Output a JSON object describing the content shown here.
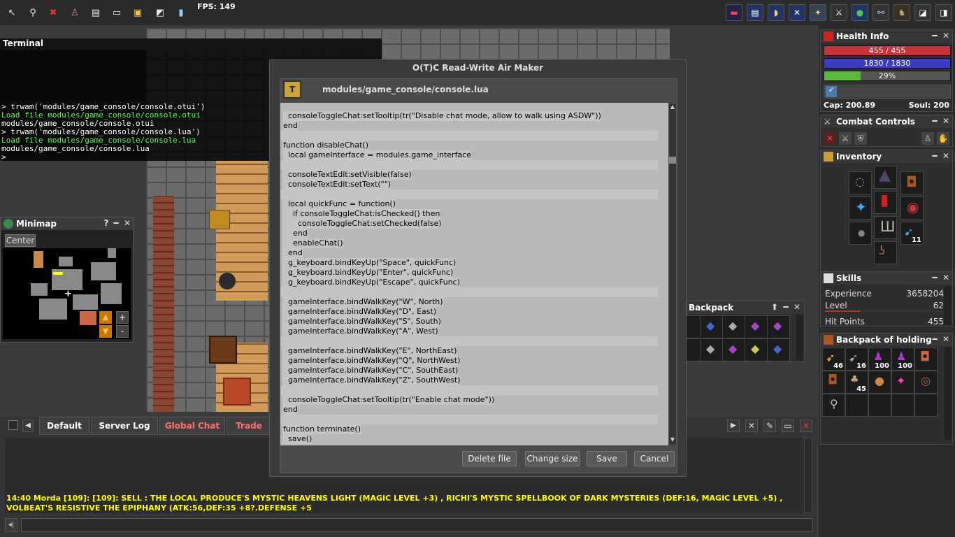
{
  "topbar": {
    "fps": "FPS: 149",
    "left_icons": [
      "arrow-icon",
      "walk-icon",
      "logout-icon",
      "character-icon",
      "quest-icon",
      "console-icon",
      "box-icon",
      "window-icon",
      "potion-icon"
    ],
    "right_icons": [
      "health-icon",
      "skills-icon",
      "inventory-icon",
      "battle-icon",
      "vip-icon",
      "combat-icon",
      "world-icon",
      "link-icon",
      "outfit-icon",
      "minimize-icon",
      "fullscreen-icon"
    ]
  },
  "terminal": {
    "title": "Terminal",
    "lines": [
      {
        "text": "> trwam('modules/game_console/console.otui')",
        "color": "#ffffff"
      },
      {
        "text": "Load file modules/game_console/console.otui",
        "color": "#55ff55"
      },
      {
        "text": "modules/game_console/console.otui",
        "color": "#ffffff"
      },
      {
        "text": "> trwam('modules/game_console/console.lua')",
        "color": "#ffffff"
      },
      {
        "text": "Load file modules/game_console/console.lua",
        "color": "#55ff55"
      },
      {
        "text": "modules/game_console/console.lua",
        "color": "#ffffff"
      },
      {
        "text": ">",
        "color": "#ffffff"
      }
    ]
  },
  "minimap": {
    "title": "Minimap",
    "help": "?",
    "center_label": "Center",
    "zoom_in": "+",
    "zoom_out": "-"
  },
  "dialog": {
    "title": "O(T)C Read-Write Air Maker",
    "file_path": "modules/game_console/console.lua",
    "code_lines": [
      "  consoleToggleChat:setTooltip(tr(\"Disable chat mode, allow to walk using ASDW\"))",
      "end",
      "",
      "function disableChat()",
      "  local gameInterface = modules.game_interface",
      "",
      "  consoleTextEdit:setVisible(false)",
      "  consoleTextEdit:setText(\"\")",
      "",
      "  local quickFunc = function()",
      "    if consoleToggleChat:isChecked() then",
      "      consoleToggleChat:setChecked(false)",
      "    end",
      "    enableChat()",
      "  end",
      "  g_keyboard.bindKeyUp(\"Space\", quickFunc)",
      "  g_keyboard.bindKeyUp(\"Enter\", quickFunc)",
      "  g_keyboard.bindKeyUp(\"Escape\", quickFunc)",
      "",
      "  gameInterface.bindWalkKey(\"W\", North)",
      "  gameInterface.bindWalkKey(\"D\", East)",
      "  gameInterface.bindWalkKey(\"S\", South)",
      "  gameInterface.bindWalkKey(\"A\", West)",
      "",
      "  gameInterface.bindWalkKey(\"E\", NorthEast)",
      "  gameInterface.bindWalkKey(\"Q\", NorthWest)",
      "  gameInterface.bindWalkKey(\"C\", SouthEast)",
      "  gameInterface.bindWalkKey(\"Z\", SouthWest)",
      "",
      "  consoleToggleChat:setTooltip(tr(\"Enable chat mode\"))",
      "end",
      "",
      "function terminate()",
      "  save()"
    ],
    "buttons": {
      "delete": "Delete file",
      "change_size": "Change size",
      "save": "Save",
      "cancel": "Cancel"
    }
  },
  "health": {
    "title": "Health Info",
    "hp": "455 / 455",
    "mana": "1830 / 1830",
    "exp_percent": "29%",
    "exp_fraction": 0.29,
    "cap": "Cap: 200.89",
    "soul": "Soul: 200"
  },
  "combat": {
    "title": "Combat Controls"
  },
  "inventory": {
    "title": "Inventory",
    "arrow_count": "11"
  },
  "skills": {
    "title": "Skills",
    "rows": [
      {
        "label": "Experience",
        "value": "3658204"
      },
      {
        "label": "Level",
        "value": "62"
      },
      {
        "label": "Hit Points",
        "value": "455"
      }
    ]
  },
  "backpack": {
    "title": "Backpack"
  },
  "backpack_holding": {
    "title": "Backpack of holding",
    "counts": [
      "46",
      "16",
      "100",
      "100",
      "",
      "",
      "45",
      "",
      "",
      ""
    ]
  },
  "chat": {
    "tabs": [
      {
        "label": "Default",
        "color": "#ffffff"
      },
      {
        "label": "Server Log",
        "color": "#ffffff"
      },
      {
        "label": "Global Chat",
        "color": "#ff7070"
      },
      {
        "label": "Trade",
        "color": "#ff7070"
      }
    ],
    "message": "14:40 Morda [109]: [109]: SELL :  THE LOCAL PRODUCE'S MYSTIC HEAVENS LIGHT (MAGIC LEVEL +3) ,  RICHI'S MYSTIC SPELLBOOK OF DARK MYSTERIES (DEF:16, MAGIC LEVEL +5) , VOLBEAT'S RESISTIVE THE EPIPHANY (ATK:56,DEF:35 +8?.DEFENSE +5"
  }
}
